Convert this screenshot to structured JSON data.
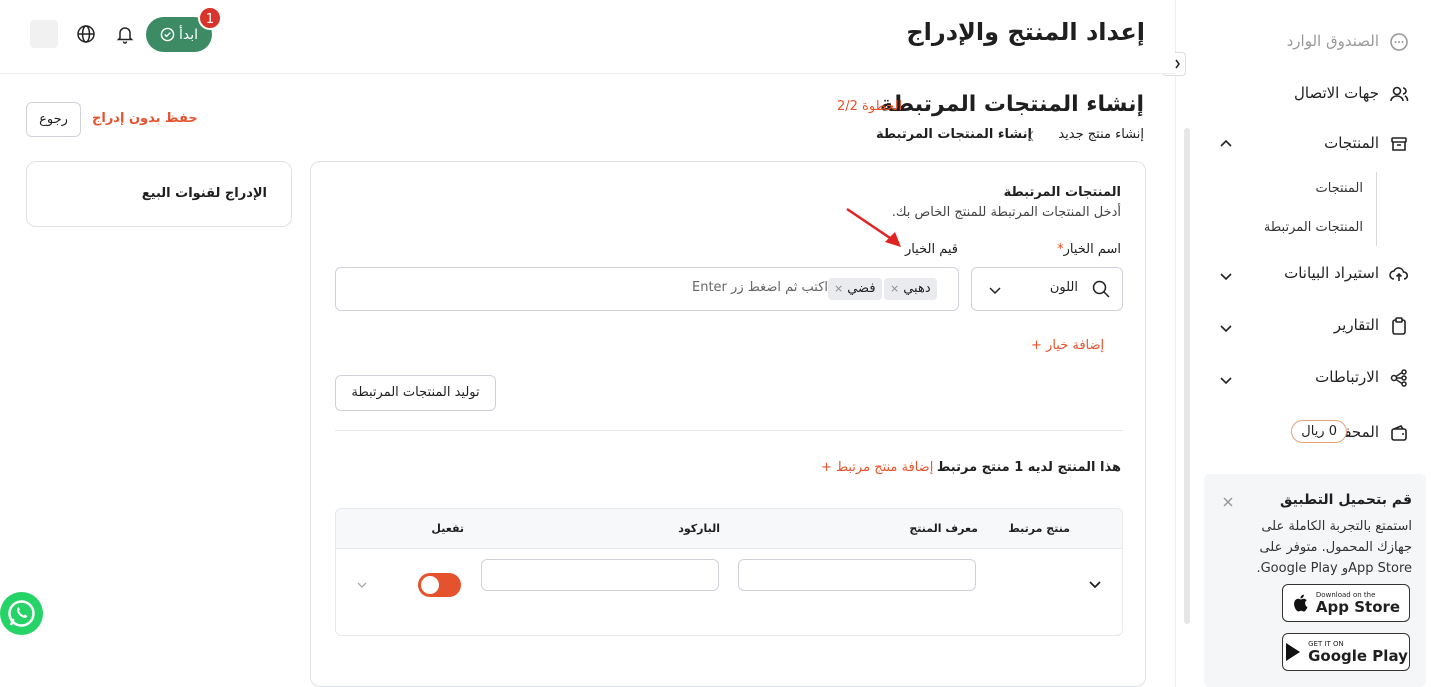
{
  "sidebar": {
    "items": [
      {
        "label": "الصندوق الوارد",
        "icon": "chat-bubble-icon"
      },
      {
        "label": "جهات الاتصال",
        "icon": "users-icon"
      },
      {
        "label": "المنتجات",
        "icon": "box-icon"
      },
      {
        "label": "استيراد البيانات",
        "icon": "cloud-upload-icon"
      },
      {
        "label": "التقارير",
        "icon": "clipboard-icon"
      },
      {
        "label": "الارتباطات",
        "icon": "share-nodes-icon"
      },
      {
        "label": "المحفظة",
        "icon": "wallet-icon"
      }
    ],
    "sub_items": [
      "المنتجات",
      "المنتجات المرتبطة"
    ],
    "wallet_balance": "0 ريال",
    "promo": {
      "title": "قم بتحميل التطبيق",
      "text": "استمتع بالتجربة الكاملة على جهازك المحمول. متوفر على App Storeو Google Play.",
      "appstore_small": "Download on the",
      "appstore_big": "App Store",
      "gplay_small": "GET IT ON",
      "gplay_big": "Google Play"
    }
  },
  "header": {
    "title": "إعداد المنتج والإدراج",
    "start_label": "ابدأ",
    "badge_count": "1"
  },
  "page": {
    "section_title": "إنشاء المنتجات المرتبطة",
    "step": "الخطوة 2/2",
    "breadcrumb": [
      "إنشاء منتج جديد",
      "إنشاء المنتجات المرتبطة"
    ],
    "back_label": "رجوع",
    "save_label": "حفظ بدون إدراج"
  },
  "left_card": {
    "title": "الإدراج لقنوات البيع"
  },
  "main_card": {
    "title": "المنتجات المرتبطة",
    "subtitle": "أدخل المنتجات المرتبطة للمنتج الخاص بك.",
    "option_name_label": "اسم الخيار",
    "option_values_label": "قيم الخيار",
    "selected_option": "اللون",
    "tags": [
      "دهبي",
      "فضي"
    ],
    "tag_placeholder": "اكتب ثم اضغط زر Enter",
    "add_option": "إضافة خيار",
    "generate_label": "توليد المنتجات المرتبطة",
    "count_text": "هذا المنتج لديه 1 منتج مرتبط",
    "add_related": "إضافة منتج مرتبط",
    "table_headers": [
      "منتج مرتبط",
      "معرف المنتج",
      "الباركود",
      "تفعيل"
    ]
  },
  "colors": {
    "accent": "#e5532e",
    "primary_green": "#3c8b64",
    "whatsapp": "#25d366"
  }
}
